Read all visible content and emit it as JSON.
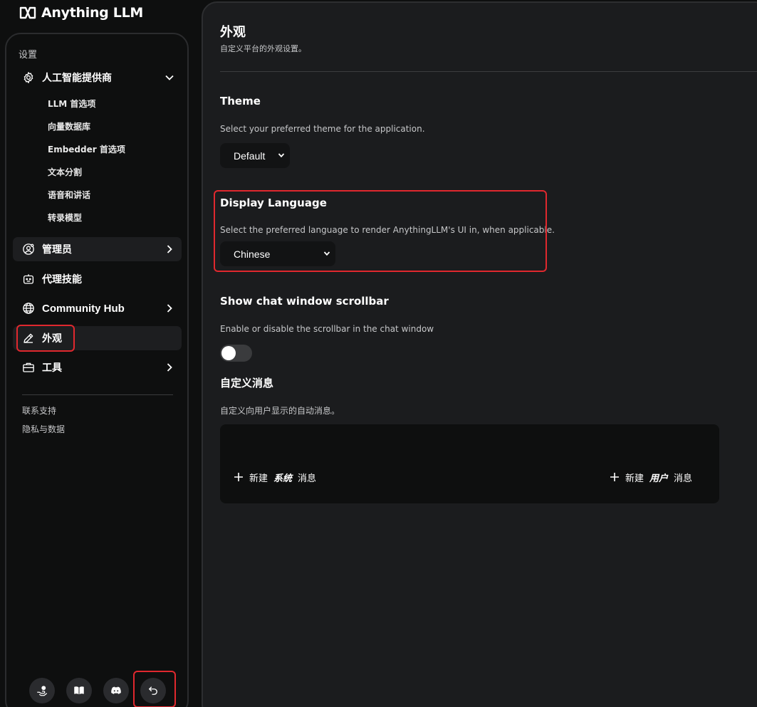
{
  "brand": {
    "name": "Anything LLM"
  },
  "sidebar": {
    "section_title": "设置",
    "ai_providers": {
      "label": "人工智能提供商",
      "icon": "gear-icon",
      "expanded": true,
      "children": [
        "LLM 首选项",
        "向量数据库",
        "Embedder 首选项",
        "文本分割",
        "语音和讲话",
        "转录模型"
      ]
    },
    "items": [
      {
        "label": "管理员",
        "icon": "user-gear-icon"
      },
      {
        "label": "代理技能",
        "icon": "robot-icon"
      },
      {
        "label": "Community Hub",
        "icon": "globe-icon"
      },
      {
        "label": "外观",
        "icon": "pencil-icon",
        "active": true
      },
      {
        "label": "工具",
        "icon": "toolbox-icon"
      }
    ],
    "footer_links": [
      "联系支持",
      "隐私与数据"
    ],
    "bottom_buttons": [
      "hand-coin-icon",
      "book-icon",
      "discord-icon",
      "back-arrow-icon"
    ]
  },
  "main": {
    "title": "外观",
    "subtitle": "自定义平台的外观设置。",
    "theme": {
      "title": "Theme",
      "description": "Select your preferred theme for the application.",
      "value": "Default"
    },
    "language": {
      "title": "Display Language",
      "description": "Select the preferred language to render AnythingLLM's UI in, when applicable.",
      "value": "Chinese"
    },
    "scrollbar": {
      "title": "Show chat window scrollbar",
      "description": "Enable or disable the scrollbar in the chat window",
      "enabled": false
    },
    "custom_messages": {
      "title": "自定义消息",
      "description": "自定义向用户显示的自动消息。",
      "new_system": {
        "prefix": "新建",
        "emphasis": "系统",
        "suffix": "消息"
      },
      "new_user": {
        "prefix": "新建",
        "emphasis": "用户",
        "suffix": "消息"
      }
    }
  },
  "colors": {
    "background": "#0e0f0f",
    "panel": "#1b1c1e",
    "highlight_border": "#e0282e",
    "toggle_off": "#3a3b3d"
  }
}
